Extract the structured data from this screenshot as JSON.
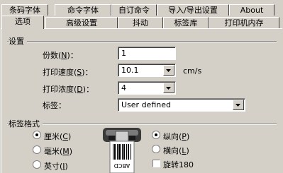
{
  "tabs_row1": [
    "条码字体",
    "命令字体",
    "自订命令",
    "导入/导出设置",
    "About"
  ],
  "tabs_row2": [
    "选项",
    "高级设置",
    "抖动",
    "标签库",
    "打印机内存"
  ],
  "active_tab": "选项",
  "settings": {
    "group_title": "设置",
    "copies_label": "份数",
    "copies_key": "N",
    "copies_value": "1",
    "speed_label": "打印速度",
    "speed_key": "S",
    "speed_value": "10.1",
    "speed_unit": "cm/s",
    "darkness_label": "打印浓度",
    "darkness_key": "D",
    "darkness_value": "4",
    "stock_label": "标签",
    "stock_value": "User defined"
  },
  "label_format": {
    "group_title": "标签格式",
    "mm_label": "厘米",
    "mm_key": "C",
    "cm_label": "毫米",
    "cm_key": "M",
    "inch_label": "英寸",
    "inch_key": "I",
    "portrait_label": "纵向",
    "portrait_key": "P",
    "landscape_label": "横向",
    "landscape_key": "L",
    "rotate_label": "旋转180",
    "selected_unit": "厘米",
    "selected_orientation": "纵向",
    "rotate_checked": false,
    "printer_illustration_text": "ABCD"
  }
}
